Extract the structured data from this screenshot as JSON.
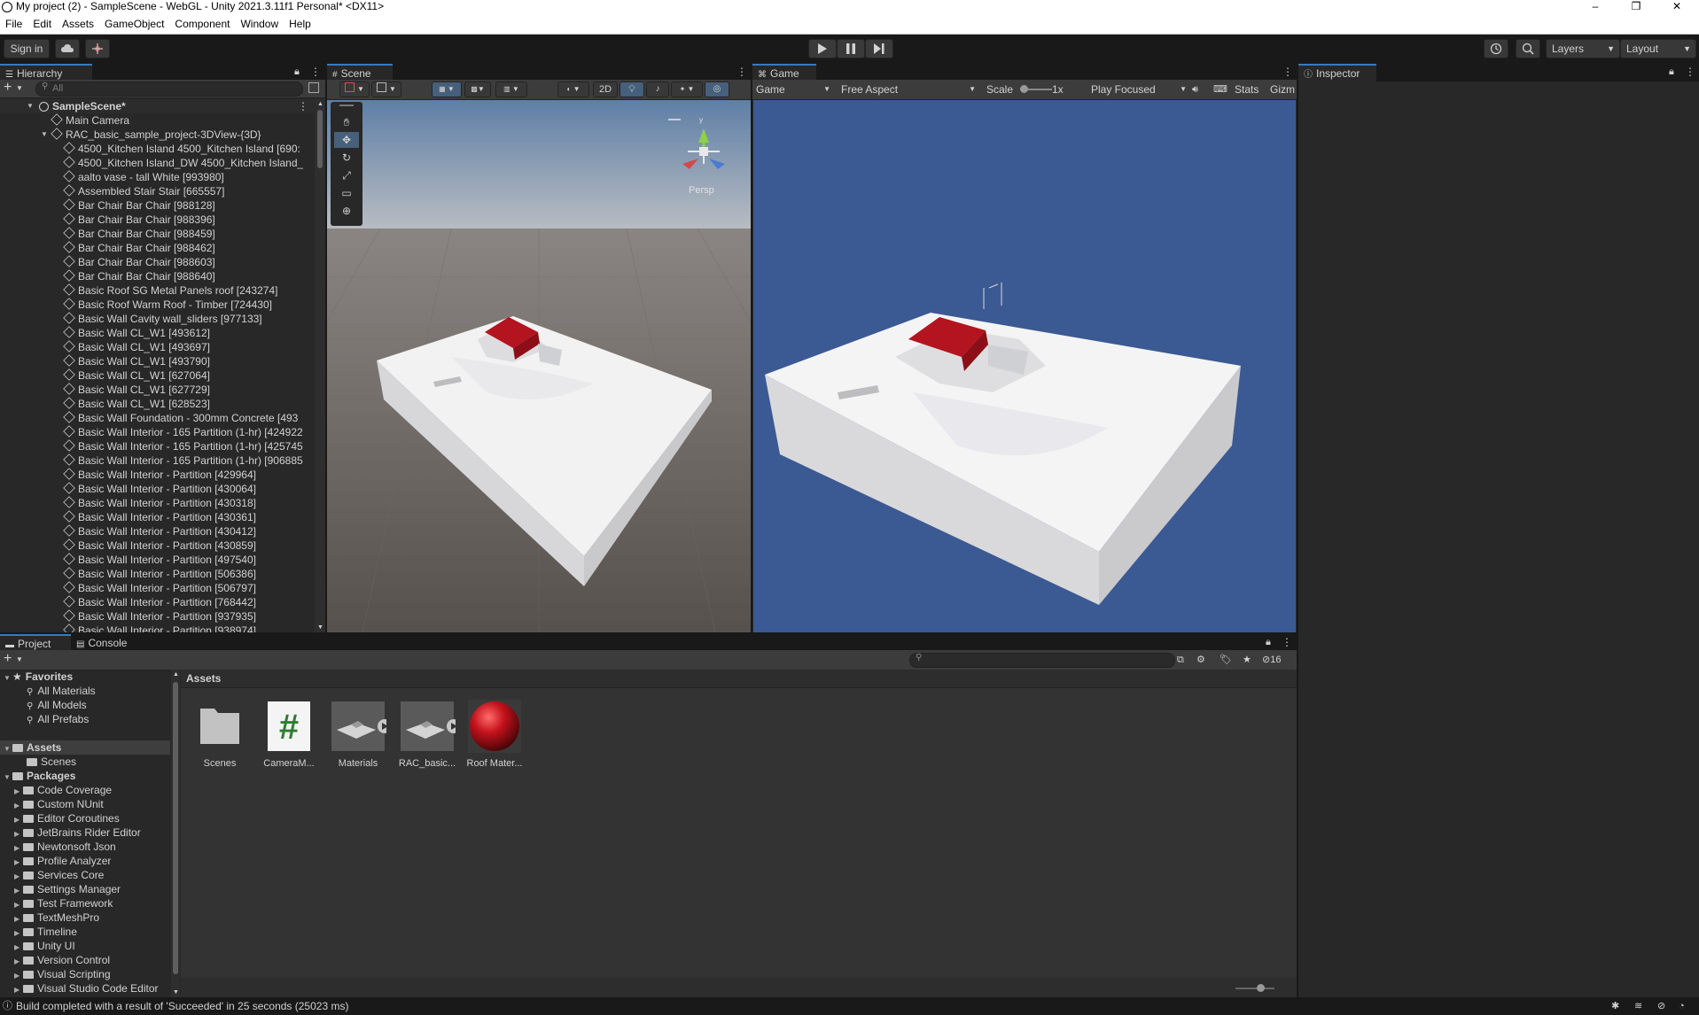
{
  "window": {
    "title": "My project (2) - SampleScene - WebGL - Unity 2021.3.11f1 Personal* <DX11>",
    "min_glyph": "–",
    "max_glyph": "❐",
    "close_glyph": "✕"
  },
  "menu": [
    "File",
    "Edit",
    "Assets",
    "GameObject",
    "Component",
    "Window",
    "Help"
  ],
  "toolbar": {
    "sign_in": "Sign in",
    "layers": "Layers",
    "layout": "Layout"
  },
  "hierarchy": {
    "tab": "Hierarchy",
    "search_placeholder": "All",
    "scene": "SampleScene*",
    "items": [
      {
        "label": "Main Camera",
        "indent": 1
      },
      {
        "label": "RAC_basic_sample_project-3DView-{3D}",
        "indent": 1
      },
      {
        "label": "4500_Kitchen Island 4500_Kitchen Island [690:",
        "indent": 2
      },
      {
        "label": "4500_Kitchen Island_DW 4500_Kitchen Island_",
        "indent": 2
      },
      {
        "label": "aalto vase - tall White [993980]",
        "indent": 2
      },
      {
        "label": "Assembled Stair Stair [665557]",
        "indent": 2
      },
      {
        "label": "Bar Chair Bar Chair [988128]",
        "indent": 2
      },
      {
        "label": "Bar Chair Bar Chair [988396]",
        "indent": 2
      },
      {
        "label": "Bar Chair Bar Chair [988459]",
        "indent": 2
      },
      {
        "label": "Bar Chair Bar Chair [988462]",
        "indent": 2
      },
      {
        "label": "Bar Chair Bar Chair [988603]",
        "indent": 2
      },
      {
        "label": "Bar Chair Bar Chair [988640]",
        "indent": 2
      },
      {
        "label": "Basic Roof SG Metal Panels roof [243274]",
        "indent": 2
      },
      {
        "label": "Basic Roof Warm Roof - Timber [724430]",
        "indent": 2
      },
      {
        "label": "Basic Wall Cavity wall_sliders [977133]",
        "indent": 2
      },
      {
        "label": "Basic Wall CL_W1 [493612]",
        "indent": 2
      },
      {
        "label": "Basic Wall CL_W1 [493697]",
        "indent": 2
      },
      {
        "label": "Basic Wall CL_W1 [493790]",
        "indent": 2
      },
      {
        "label": "Basic Wall CL_W1 [627064]",
        "indent": 2
      },
      {
        "label": "Basic Wall CL_W1 [627729]",
        "indent": 2
      },
      {
        "label": "Basic Wall CL_W1 [628523]",
        "indent": 2
      },
      {
        "label": "Basic Wall Foundation - 300mm Concrete [493",
        "indent": 2
      },
      {
        "label": "Basic Wall Interior - 165 Partition (1-hr) [424922",
        "indent": 2
      },
      {
        "label": "Basic Wall Interior - 165 Partition (1-hr) [425745",
        "indent": 2
      },
      {
        "label": "Basic Wall Interior - 165 Partition (1-hr) [906885",
        "indent": 2
      },
      {
        "label": "Basic Wall Interior - Partition [429964]",
        "indent": 2
      },
      {
        "label": "Basic Wall Interior - Partition [430064]",
        "indent": 2
      },
      {
        "label": "Basic Wall Interior - Partition [430318]",
        "indent": 2
      },
      {
        "label": "Basic Wall Interior - Partition [430361]",
        "indent": 2
      },
      {
        "label": "Basic Wall Interior - Partition [430412]",
        "indent": 2
      },
      {
        "label": "Basic Wall Interior - Partition [430859]",
        "indent": 2
      },
      {
        "label": "Basic Wall Interior - Partition [497540]",
        "indent": 2
      },
      {
        "label": "Basic Wall Interior - Partition [506386]",
        "indent": 2
      },
      {
        "label": "Basic Wall Interior - Partition [506797]",
        "indent": 2
      },
      {
        "label": "Basic Wall Interior - Partition [768442]",
        "indent": 2
      },
      {
        "label": "Basic Wall Interior - Partition [937935]",
        "indent": 2
      },
      {
        "label": "Basic Wall Interior - Partition [938974]",
        "indent": 2
      }
    ]
  },
  "scene": {
    "tab": "Scene",
    "btn_2d": "2D",
    "persp": "Persp",
    "gizmo_y": "y"
  },
  "game": {
    "tab": "Game",
    "display": "Game",
    "aspect": "Free Aspect",
    "scale_label": "Scale",
    "scale_value": "1x",
    "play_mode": "Play Focused",
    "stats": "Stats",
    "gizmos": "Gizm"
  },
  "inspector": {
    "tab": "Inspector"
  },
  "project": {
    "tab_project": "Project",
    "tab_console": "Console",
    "hidden_count": "16",
    "breadcrumb": "Assets",
    "favorites_label": "Favorites",
    "favorites": [
      "All Materials",
      "All Models",
      "All Prefabs"
    ],
    "assets_label": "Assets",
    "assets_children": [
      "Scenes"
    ],
    "packages_label": "Packages",
    "packages": [
      "Code Coverage",
      "Custom NUnit",
      "Editor Coroutines",
      "JetBrains Rider Editor",
      "Newtonsoft Json",
      "Profile Analyzer",
      "Services Core",
      "Settings Manager",
      "Test Framework",
      "TextMeshPro",
      "Timeline",
      "Unity UI",
      "Version Control",
      "Visual Scripting",
      "Visual Studio Code Editor"
    ],
    "grid_items": [
      {
        "label": "Scenes",
        "kind": "folder"
      },
      {
        "label": "CameraM...",
        "kind": "script"
      },
      {
        "label": "Materials",
        "kind": "model"
      },
      {
        "label": "RAC_basic...",
        "kind": "model"
      },
      {
        "label": "Roof Mater...",
        "kind": "material"
      }
    ]
  },
  "status": {
    "message": "Build completed with a result of 'Succeeded' in 25 seconds (25023 ms)"
  },
  "colors": {
    "accent": "#3a79bb",
    "game_bg": "#3b5a93",
    "roof_red": "#b3141f"
  }
}
